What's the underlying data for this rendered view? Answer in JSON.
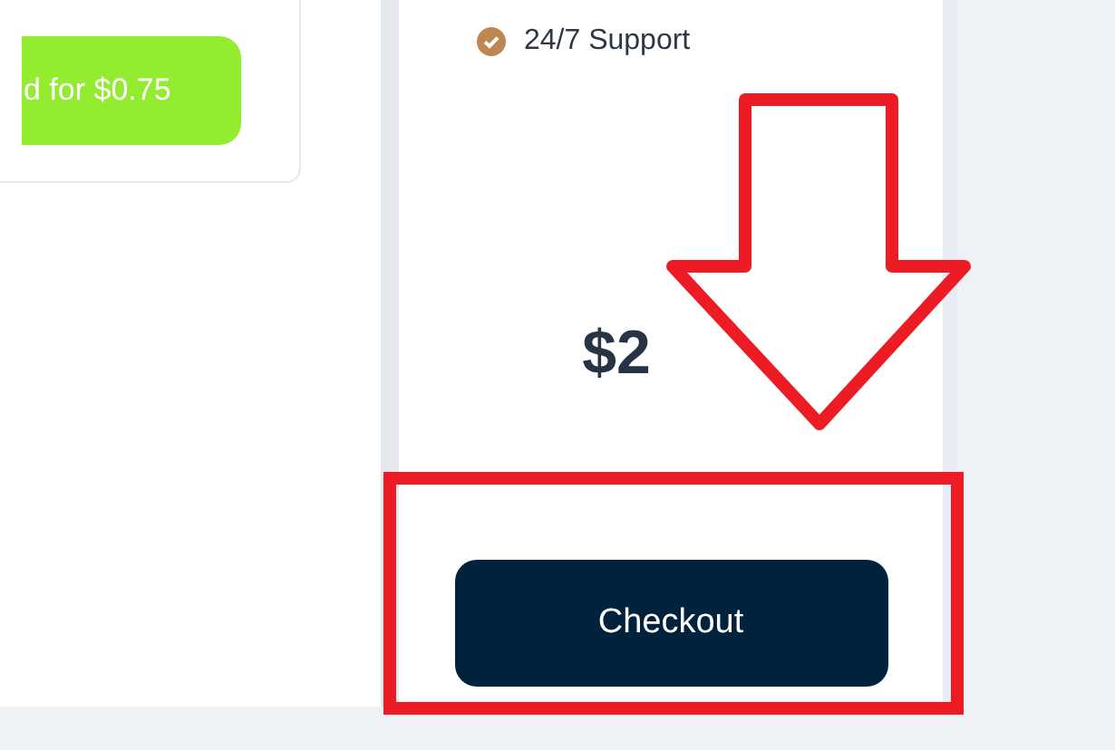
{
  "left_card": {
    "button": "d for $0.75"
  },
  "plan_card": {
    "features": [
      {
        "label": "24/7 Support",
        "included": true
      }
    ],
    "price": "$2",
    "button": "Checkout"
  },
  "annotations": {
    "arrow": true,
    "highlight_box": true
  }
}
